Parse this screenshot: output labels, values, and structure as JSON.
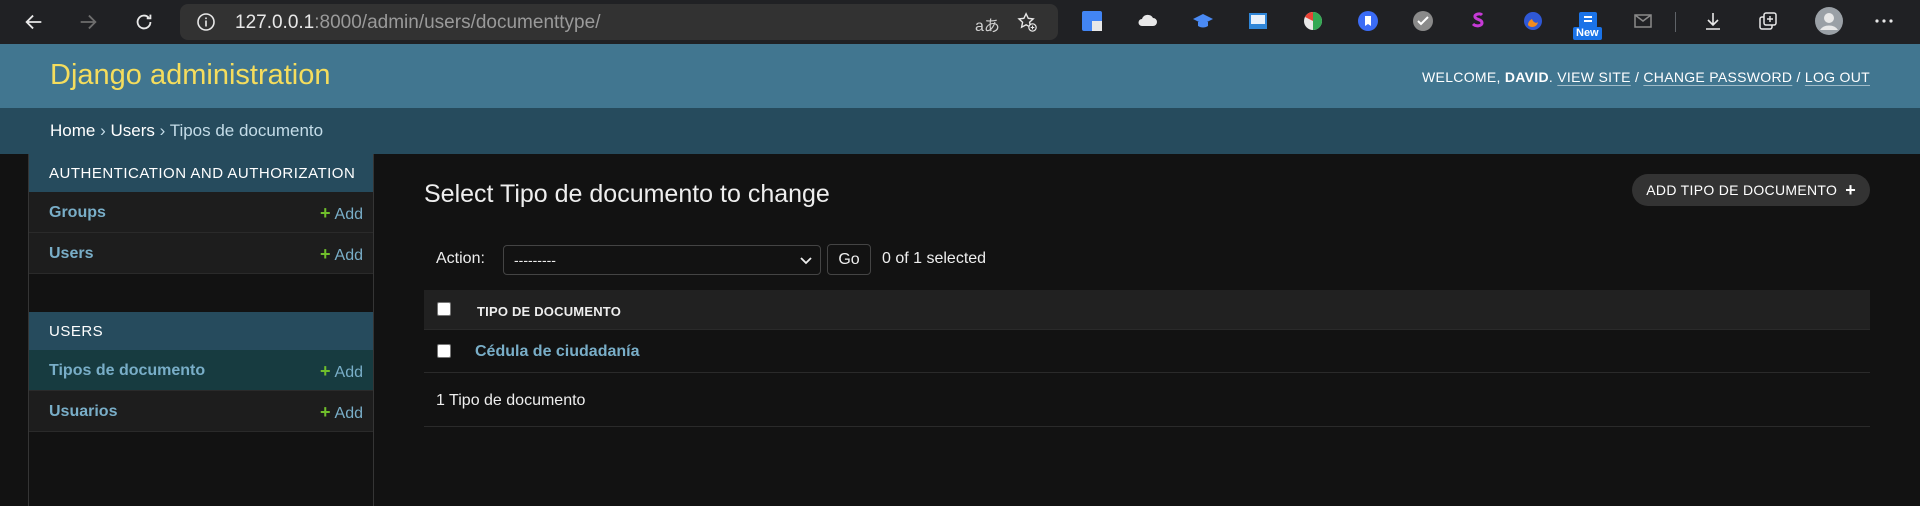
{
  "browser": {
    "url_host": "127.0.0.1",
    "url_rest": ":8000/admin/users/documenttype/",
    "translate_glyph": "aあ",
    "new_badge": "New"
  },
  "header": {
    "branding": "Django administration",
    "welcome": "WELCOME, ",
    "username": "DAVID",
    "view_site": "VIEW SITE",
    "change_password": "CHANGE PASSWORD",
    "log_out": "LOG OUT",
    "separator": " / "
  },
  "breadcrumbs": {
    "home": "Home",
    "app": "Users",
    "current": "Tipos de documento",
    "sep": " › "
  },
  "sidebar": {
    "modules": [
      {
        "caption": "AUTHENTICATION AND AUTHORIZATION",
        "items": [
          {
            "name": "Groups",
            "add": "Add"
          },
          {
            "name": "Users",
            "add": "Add"
          }
        ]
      },
      {
        "caption": "USERS",
        "items": [
          {
            "name": "Tipos de documento",
            "add": "Add"
          },
          {
            "name": "Usuarios",
            "add": "Add"
          }
        ]
      }
    ]
  },
  "content": {
    "title": "Select Tipo de documento to change",
    "add_button": "ADD TIPO DE DOCUMENTO",
    "actions": {
      "label": "Action:",
      "selected_option": "---------",
      "go": "Go",
      "count": "0 of 1 selected"
    },
    "table": {
      "header": "TIPO DE DOCUMENTO",
      "rows": [
        "Cédula de ciudadanía"
      ]
    },
    "paginator": "1 Tipo de documento"
  },
  "colors": {
    "header_bg": "#417690",
    "branding": "#f5dd5d",
    "breadcrumbs_bg": "#264b5d",
    "link": "#79aec8",
    "add_plus": "#70bf2b"
  }
}
